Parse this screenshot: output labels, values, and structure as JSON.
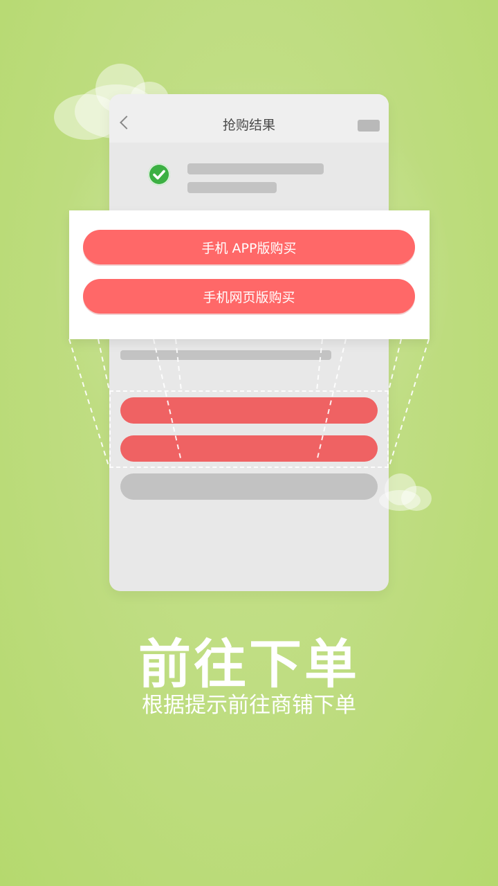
{
  "phone": {
    "title": "抢购结果"
  },
  "card": {
    "app_button_label": "手机 APP版购买",
    "web_button_label": "手机网页版购买"
  },
  "headline": "前往下单",
  "subline": "根据提示前往商铺下单",
  "colors": {
    "background": "#bfdd82",
    "accent_red": "#ff6868",
    "success_green": "#3cb043"
  },
  "icons": {
    "back": "chevron-left-icon",
    "success": "check-circle-icon"
  }
}
